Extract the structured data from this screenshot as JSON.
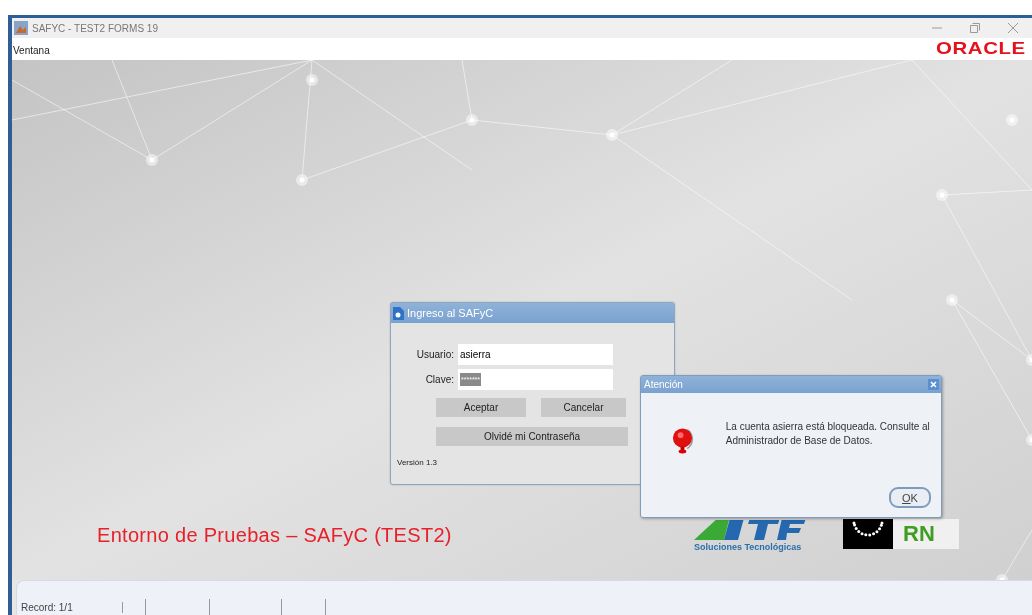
{
  "window": {
    "title": "SAFYC - TEST2 FORMS 19"
  },
  "menu": [
    {
      "label": "Ventana"
    }
  ],
  "brand": "ORACLE",
  "login_dialog": {
    "title": "Ingreso al SAFyC",
    "fields": [
      {
        "label": "Usuario:",
        "value": "asierra",
        "kind": "text"
      },
      {
        "label": "Clave:",
        "value": "*******",
        "kind": "password"
      }
    ],
    "buttons": [
      "Aceptar",
      "Cancelar"
    ],
    "wide_button": "Olvidé mi Contraseña",
    "version": "Versión 1.3"
  },
  "alert_dialog": {
    "title": "Atención",
    "message": "La cuenta asierra está bloqueada. Consulte al Administrador de Base de Datos.",
    "button": "OK"
  },
  "banner": "Entorno de Pruebas – SAFyC (TEST2)",
  "logos": {
    "caption": "Soluciones Tecnológicas",
    "rn": "RN"
  },
  "status_bar": {
    "record": "Record: 1/1"
  }
}
